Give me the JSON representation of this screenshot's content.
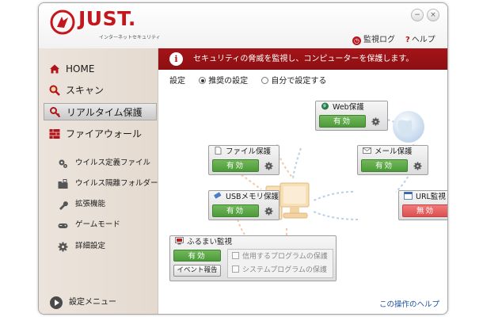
{
  "app": {
    "brand": "JUST.",
    "brand_sub": "インターネットセキュリティ",
    "minimize_glyph": "−",
    "close_glyph": "×"
  },
  "top_links": {
    "log": "監視ログ",
    "help": "ヘルプ",
    "help_mark": "?"
  },
  "sidebar": {
    "items": [
      {
        "label": "HOME",
        "icon": "home-icon"
      },
      {
        "label": "スキャン",
        "icon": "magnifier-icon"
      },
      {
        "label": "リアルタイム保護",
        "icon": "key-icon",
        "active": true
      },
      {
        "label": "ファイアウォール",
        "icon": "firewall-icon"
      }
    ],
    "sub_items": [
      {
        "label": "ウイルス定義ファイル",
        "icon": "gears-icon"
      },
      {
        "label": "ウイルス隔離フォルダー",
        "icon": "folder-lock-icon"
      },
      {
        "label": "拡張機能",
        "icon": "wrench-icon"
      },
      {
        "label": "ゲームモード",
        "icon": "gamepad-icon"
      },
      {
        "label": "詳細設定",
        "icon": "gear-icon"
      }
    ],
    "settings_menu": "設定メニュー"
  },
  "banner": {
    "info_glyph": "i",
    "text": "セキュリティの脅威を監視し、コンピューターを保護します。"
  },
  "mode": {
    "label": "設定",
    "recommended": "推奨の設定",
    "custom": "自分で設定する",
    "selected": "recommended"
  },
  "cards": {
    "web": {
      "title": "Web保護",
      "state": "有効"
    },
    "file": {
      "title": "ファイル保護",
      "state": "有効"
    },
    "mail": {
      "title": "メール保護",
      "state": "有効"
    },
    "usb": {
      "title": "USBメモリ保護",
      "state": "有効"
    },
    "url": {
      "title": "URL監視",
      "state": "無効"
    }
  },
  "behavior": {
    "title": "ふるまい監視",
    "state": "有効",
    "report_button": "イベント報告",
    "options": [
      {
        "label": "信用するプログラムの保護",
        "checked": false,
        "enabled": false
      },
      {
        "label": "システムプログラムの保護",
        "checked": false,
        "enabled": false
      }
    ]
  },
  "help_link": "この操作のヘルプ",
  "colors": {
    "brand_red": "#c4161c",
    "banner_red": "#a51418",
    "enabled_green": "#5aa845",
    "disabled_red": "#e26060",
    "link_blue": "#1a4fa0"
  }
}
